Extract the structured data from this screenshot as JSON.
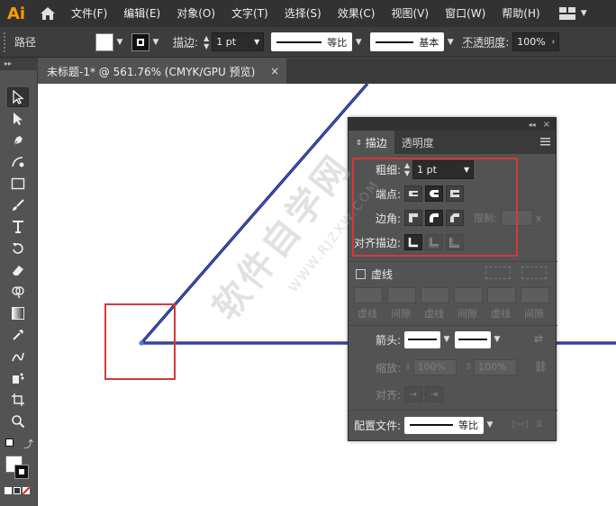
{
  "app": {
    "logo": "Ai"
  },
  "menu": [
    "文件(F)",
    "编辑(E)",
    "对象(O)",
    "文字(T)",
    "选择(S)",
    "效果(C)",
    "视图(V)",
    "窗口(W)",
    "帮助(H)"
  ],
  "control_bar": {
    "object_label": "路径",
    "stroke_label": "描边",
    "stroke_weight": "1 pt",
    "profile_label": "等比",
    "brush_label": "基本",
    "opacity_label": "不透明度",
    "opacity_value": "100%"
  },
  "document_tab": {
    "title": "未标题-1* @ 561.76% (CMYK/GPU 预览)",
    "close": "×"
  },
  "stroke_panel": {
    "tabs": [
      "描边",
      "透明度"
    ],
    "weight_label": "粗细",
    "weight_value": "1 pt",
    "cap_label": "端点",
    "corner_label": "边角",
    "limit_label": "限制",
    "limit_suffix": "x",
    "align_label": "对齐描边",
    "dashed_label": "虚线",
    "dash_labels": [
      "虚线",
      "间隙",
      "虚线",
      "间隙",
      "虚线",
      "间隙"
    ],
    "arrowheads_label": "箭头",
    "scale_label": "缩放",
    "scale_values": [
      "100%",
      "100%"
    ],
    "arrow_align_label": "对齐",
    "profile_label": "配置文件",
    "profile_value": "等比"
  },
  "watermark": {
    "main": "软件自学网",
    "sub": "WWW.RJZXW.COM"
  },
  "colors": {
    "highlight_box": "#d23a3a",
    "app_logo": "#ff9a00",
    "path_stroke": "#1a1a6e",
    "anchor": "#4a7bd8"
  }
}
